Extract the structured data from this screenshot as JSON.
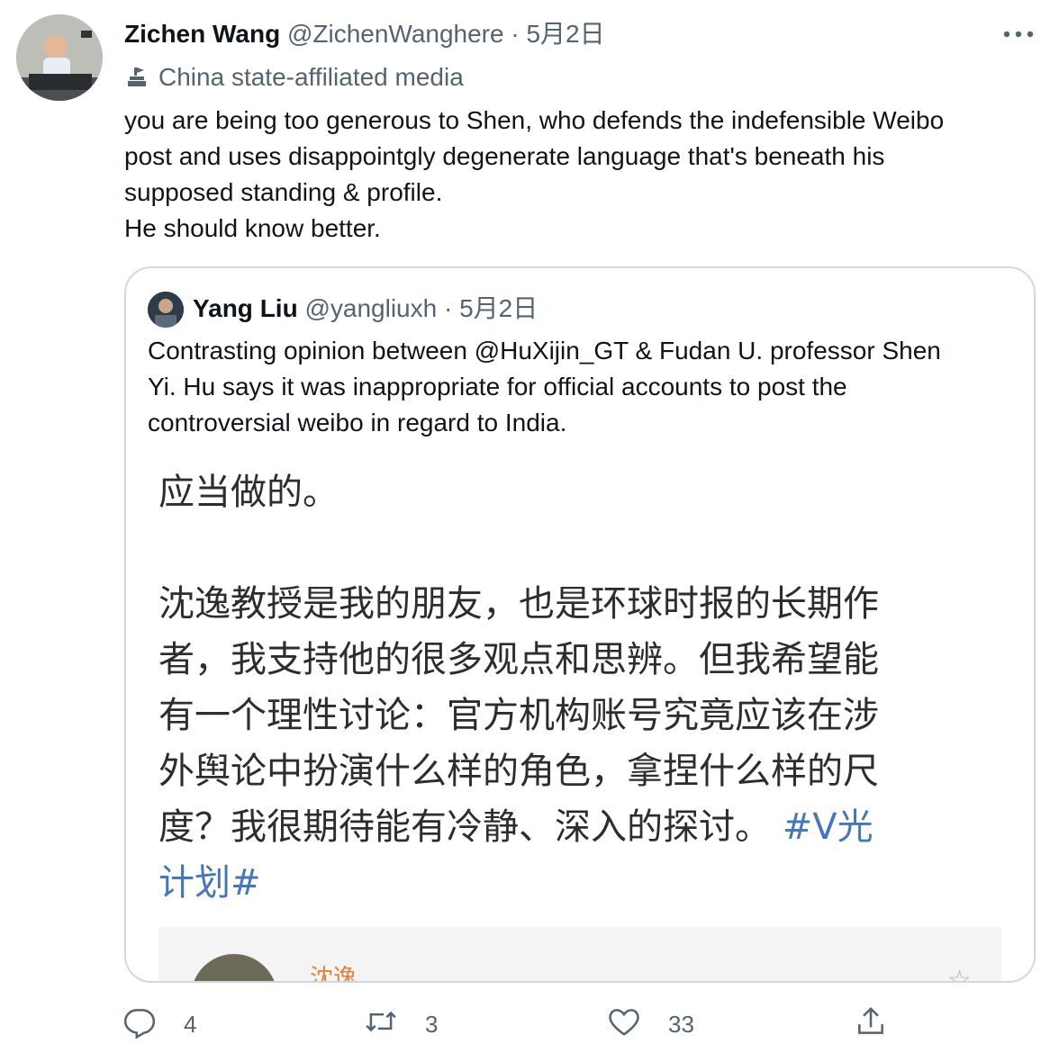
{
  "tweet": {
    "author_name": "Zichen Wang",
    "author_handle": "@ZichenWanghere",
    "dot": "·",
    "date": "5月2日",
    "affiliation_label": "China state-affiliated media",
    "text_lines": [
      "you are being too generous to Shen, who defends the indefensible Weibo",
      "post and uses disappointgly degenerate language that's beneath his",
      "supposed standing & profile.",
      "He should know better."
    ]
  },
  "quoted": {
    "author_name": "Yang Liu",
    "author_handle": "@yangliuxh",
    "dot": "·",
    "date": "5月2日",
    "text_lines": [
      "Contrasting opinion between @HuXijin_GT & Fudan U. professor Shen",
      "Yi. Hu says it was inappropriate for official accounts to post the",
      "controversial weibo in regard to India."
    ],
    "image": {
      "lines": [
        "应当做的。",
        "",
        "沈逸教授是我的朋友，也是环球时报的长期作",
        "者，我支持他的很多观点和思辨。但我希望能",
        "有一个理性讨论：官方机构账号究竟应该在涉",
        "外舆论中扮演什么样的角色，拿捏什么样的尺",
        "度？我很期待能有冷静、深入的探讨。"
      ],
      "hashtag_part1": "#V光",
      "hashtag_part2": "计划#",
      "bottom_name": "沈逸"
    }
  },
  "actions": {
    "reply_count": "4",
    "retweet_count": "3",
    "like_count": "33"
  },
  "colors": {
    "text": "#0f1419",
    "muted": "#536471",
    "border": "#cfd9de",
    "hashtag": "#4677b7"
  },
  "icons": [
    "more-icon",
    "state-media-icon",
    "reply-icon",
    "retweet-icon",
    "like-icon",
    "share-icon"
  ]
}
